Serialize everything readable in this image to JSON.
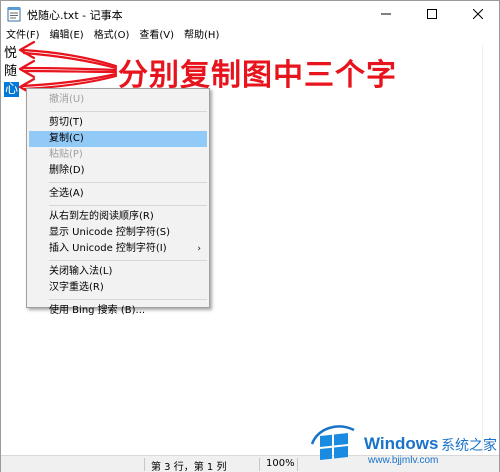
{
  "window": {
    "title": "悦随心.txt - 记事本"
  },
  "menubar": {
    "items": [
      "文件(F)",
      "编辑(E)",
      "格式(O)",
      "查看(V)",
      "帮助(H)"
    ]
  },
  "editor": {
    "lines": [
      "悦",
      "随",
      "心"
    ]
  },
  "annotation": {
    "text": "分别复制图中三个字",
    "color": "#e8141d"
  },
  "context_menu": {
    "items": [
      {
        "label": "撤消(U)",
        "state": "disabled"
      },
      {
        "label": "剪切(T)",
        "state": "normal"
      },
      {
        "label": "复制(C)",
        "state": "hover"
      },
      {
        "label": "粘贴(P)",
        "state": "disabled"
      },
      {
        "label": "删除(D)",
        "state": "normal"
      },
      {
        "label": "全选(A)",
        "state": "normal"
      },
      {
        "label": "从右到左的阅读顺序(R)",
        "state": "normal"
      },
      {
        "label": "显示 Unicode 控制字符(S)",
        "state": "normal"
      },
      {
        "label": "插入 Unicode 控制字符(I)",
        "state": "normal",
        "submenu_arrow": "›"
      },
      {
        "label": "关闭输入法(L)",
        "state": "normal"
      },
      {
        "label": "汉字重选(R)",
        "state": "normal"
      },
      {
        "label": "使用 Bing 搜索 (B)...",
        "state": "normal"
      }
    ]
  },
  "statusbar": {
    "position": "第 3 行，第 1 列",
    "zoom": "100%"
  },
  "watermark": {
    "brand": "Windows",
    "brand_suffix": "系统之家",
    "url": "www.bjjmlv.com"
  },
  "colors": {
    "selection": "#0078d7",
    "menu_hover": "#91c9f7",
    "annotation": "#e8141d",
    "watermark": "#1a73c9"
  }
}
